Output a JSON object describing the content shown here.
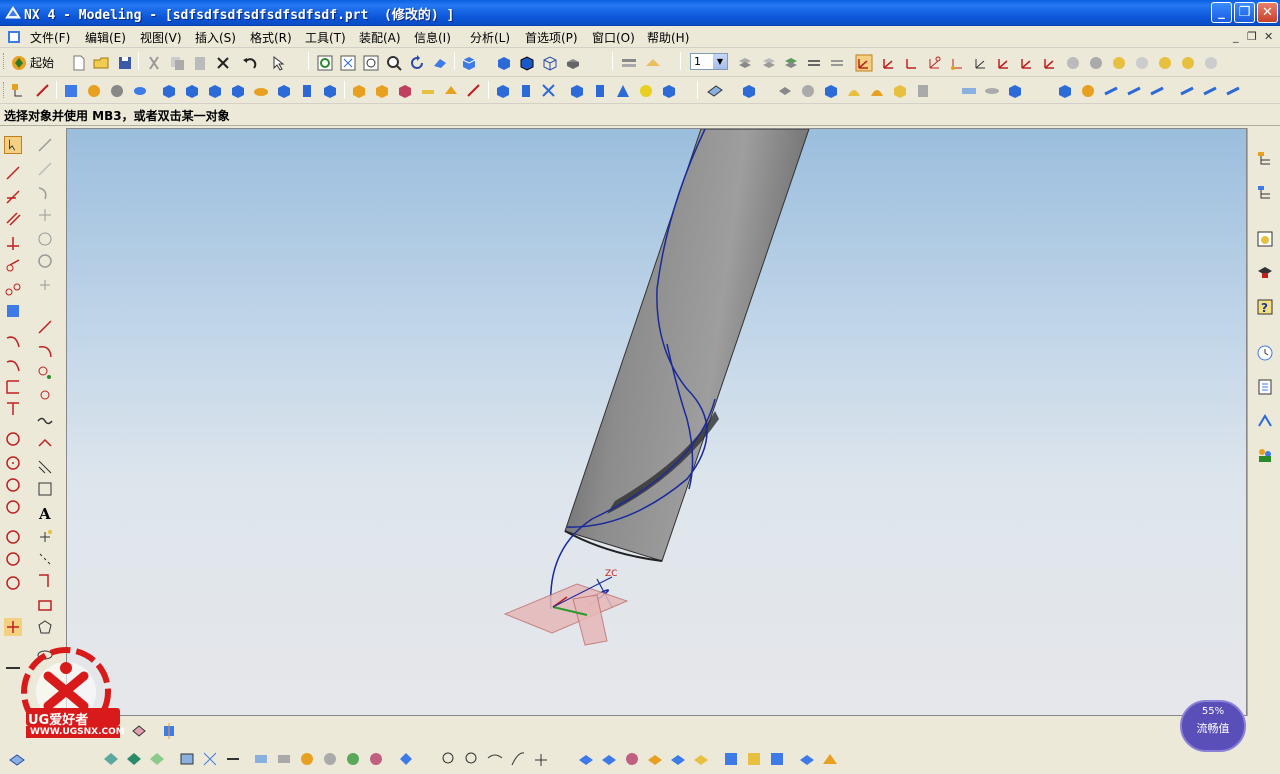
{
  "window": {
    "title": "NX 4 - Modeling - [sdfsdfsdfsdfsdfsdfsdf.prt  (修改的) ]",
    "minimize": "_",
    "restore": "❐",
    "close": "✕"
  },
  "menu": {
    "items": [
      "文件(F)",
      "编辑(E)",
      "视图(V)",
      "插入(S)",
      "格式(R)",
      "工具(T)",
      "装配(A)",
      "信息(I)",
      "分析(L)",
      "首选项(P)",
      "窗口(O)",
      "帮助(H)"
    ],
    "mdi": [
      "_",
      "❐",
      "✕"
    ]
  },
  "toolbar1": {
    "start_label": "起始",
    "layer_value": "1"
  },
  "cue_line": {
    "text": "选择对象并使用 MB3，或者双击某一对象"
  },
  "viewport": {
    "axis_label": "ZC"
  },
  "watermark": {
    "brand": "UG爱好者",
    "url": "WWW.UGSNX.COM"
  },
  "flow_badge": {
    "value": "55%",
    "label": "流畅值"
  },
  "colors": {
    "title_bar": "#0B56D8",
    "chrome": "#ECE9D8",
    "sky_top": "#9BBEDD",
    "floor": "#E6E7EA",
    "curve": "#1A2A9C",
    "body": "#7A7A7A"
  }
}
